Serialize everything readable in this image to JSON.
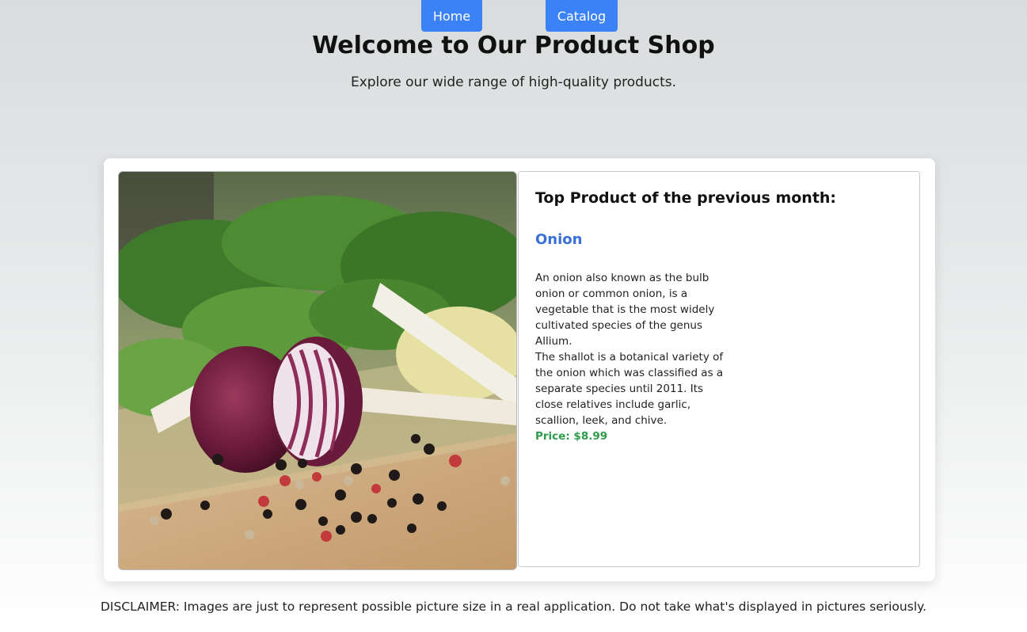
{
  "nav": {
    "home_label": "Home",
    "catalog_label": "Catalog"
  },
  "header": {
    "title": "Welcome to Our Product Shop",
    "subtitle": "Explore our wide range of high-quality products."
  },
  "featured": {
    "heading": "Top Product of the previous month:",
    "name": "Onion",
    "description_1": "An onion also known as the bulb onion or common onion, is a vegetable that is the most widely cultivated species of the genus Allium.",
    "description_2": "The shallot is a botanical variety of the onion which was classified as a separate species until 2011. Its close relatives include garlic, scallion, leek, and chive.",
    "price": "Price: $8.99",
    "image_icon": "onion-photo"
  },
  "footer": {
    "disclaimer": "DISCLAIMER: Images are just to represent possible picture size in a real application. Do not take what's displayed in pictures seriously."
  },
  "colors": {
    "accent": "#3b82f6",
    "product_name": "#3b6fd8",
    "price": "#2e9b4b"
  }
}
